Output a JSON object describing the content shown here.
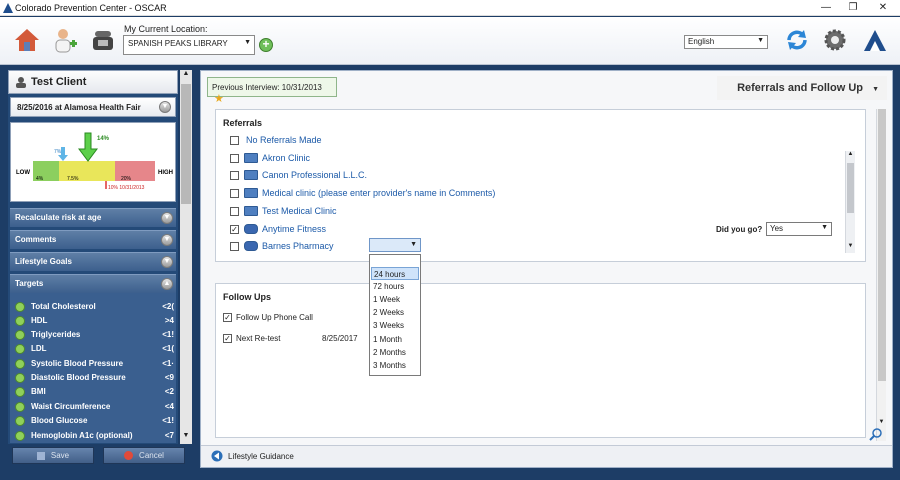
{
  "window": {
    "title": "Colorado Prevention Center - OSCAR",
    "controls": [
      "—",
      "❐",
      "✕"
    ]
  },
  "toolbar": {
    "location_label": "My Current Location:",
    "location_value": "SPANISH PEAKS LIBRARY",
    "add_location": "+",
    "language": "English"
  },
  "client": {
    "name": "Test Client",
    "visit": "8/25/2016 at Alamosa Health Fair",
    "risk": {
      "low_label": "LOW",
      "high_label": "HIGH",
      "pointer_main": "14%",
      "pointer_prev": "7%",
      "segment_low": "4%",
      "segment_mid": "7.5%",
      "segment_high": "20%",
      "marker_note": "10% 10/31/2013",
      "colors": {
        "low": "#8ccf5f",
        "mid": "#e9e65a",
        "high": "#e6868a"
      }
    }
  },
  "sidebar_sections": [
    "Recalculate risk at age",
    "Comments",
    "Lifestyle Goals",
    "Targets"
  ],
  "targets": [
    {
      "name": "Total Cholesterol",
      "value": "<2("
    },
    {
      "name": "HDL",
      "value": ">4"
    },
    {
      "name": "Triglycerides",
      "value": "<1!"
    },
    {
      "name": "LDL",
      "value": "<1("
    },
    {
      "name": "Systolic Blood Pressure",
      "value": "<1·"
    },
    {
      "name": "Diastolic Blood Pressure",
      "value": "<9"
    },
    {
      "name": "BMI",
      "value": "<2"
    },
    {
      "name": "Waist Circumference",
      "value": "<4"
    },
    {
      "name": "Blood Glucose",
      "value": "<1!"
    },
    {
      "name": "Hemoglobin A1c (optional)",
      "value": "<7"
    }
  ],
  "left_buttons": {
    "save": "Save",
    "cancel": "Cancel"
  },
  "main": {
    "previous_interview": "Previous Interview: 10/31/2013",
    "page_title": "Referrals and Follow Up",
    "referrals": {
      "header": "Referrals",
      "items": [
        {
          "label": "No Referrals Made",
          "checked": false,
          "icon": "none"
        },
        {
          "label": "Akron Clinic",
          "checked": false,
          "icon": "building-icon"
        },
        {
          "label": "Canon Professional L.L.C.",
          "checked": false,
          "icon": "building-icon"
        },
        {
          "label": "Medical clinic (please enter provider's name in Comments)",
          "checked": false,
          "icon": "building-icon"
        },
        {
          "label": "Test Medical Clinic",
          "checked": false,
          "icon": "building-icon"
        },
        {
          "label": "Anytime Fitness",
          "checked": true,
          "icon": "dumbbell-icon"
        },
        {
          "label": "Barnes Pharmacy",
          "checked": false,
          "icon": "pill-icon"
        }
      ],
      "did_you_go_label": "Did you go?",
      "did_you_go_value": "Yes"
    },
    "followups": {
      "header": "Follow Ups",
      "phone_call_label": "Follow Up Phone Call",
      "phone_call_checked": true,
      "retest_label": "Next Re-test",
      "retest_checked": true,
      "retest_date": "8/25/2017",
      "dropdown_options": [
        "24 hours",
        "72 hours",
        "1 Week",
        "2 Weeks",
        "3 Weeks",
        "1 Month",
        "2 Months",
        "3 Months"
      ],
      "selected_option": "24 hours"
    },
    "lifestyle_guidance": "Lifestyle Guidance"
  }
}
